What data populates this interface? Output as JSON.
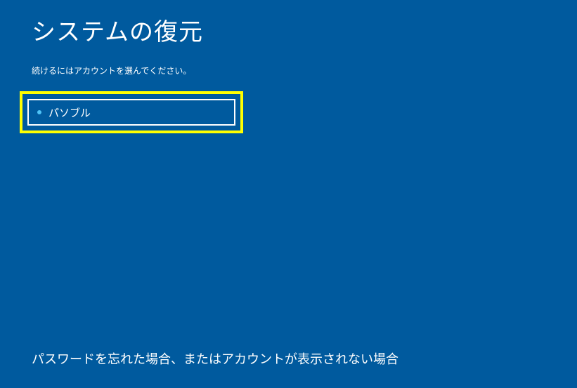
{
  "header": {
    "title": "システムの復元",
    "instruction": "続けるにはアカウントを選んでください。"
  },
  "accounts": {
    "items": [
      {
        "label": "パソブル"
      }
    ]
  },
  "footer": {
    "forgot_link": "パスワードを忘れた場合、またはアカウントが表示されない場合"
  },
  "colors": {
    "background": "#005a9e",
    "highlight": "#ffff00",
    "bullet": "#4fc3f7",
    "text": "#ffffff"
  }
}
